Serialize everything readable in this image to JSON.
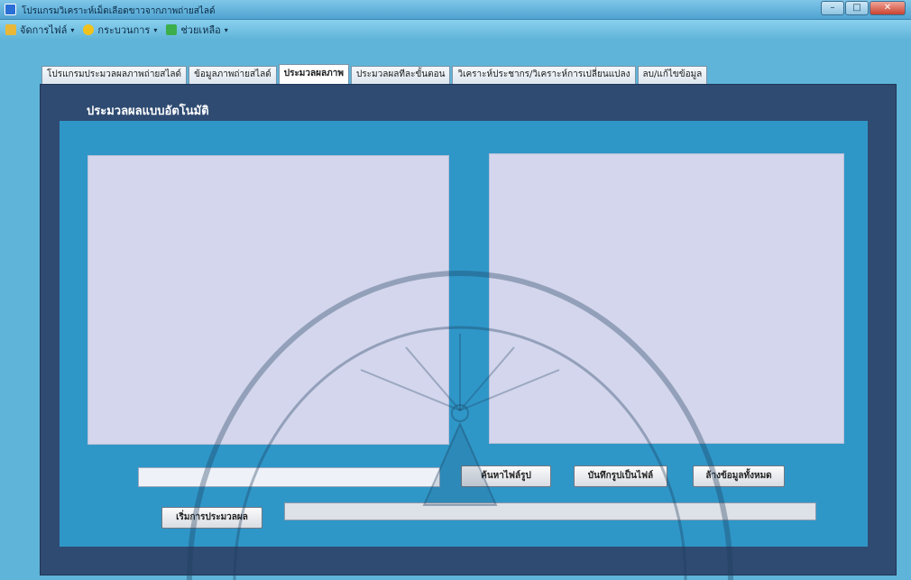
{
  "window": {
    "title": "โปรแกรมวิเคราะห์เม็ดเลือดขาวจากภาพถ่ายสไลด์",
    "controls": [
      "minimize",
      "maximize",
      "close"
    ]
  },
  "menu": {
    "items": [
      {
        "label": "จัดการไฟล์",
        "icon": "folder-icon"
      },
      {
        "label": "กระบวนการ",
        "icon": "gear-icon"
      },
      {
        "label": "ช่วยเหลือ",
        "icon": "help-icon"
      }
    ]
  },
  "tabs": [
    {
      "label": "โปรแกรมประมวลผลภาพถ่ายสไลด์"
    },
    {
      "label": "ข้อมูลภาพถ่ายสไลด์"
    },
    {
      "label": "ประมวลผลภาพ",
      "active": true
    },
    {
      "label": "ประมวลผลทีละขั้นตอน"
    },
    {
      "label": "วิเคราะห์ประชากร/วิเคราะห์การเปลี่ยนแปลง"
    },
    {
      "label": "ลบ/แก้ไขข้อมูล"
    }
  ],
  "panel": {
    "heading": "ประมวลผลแบบอัตโนมัติ"
  },
  "controls": {
    "path_input_value": "",
    "browse_button": "ค้นหาไฟล์รูป",
    "save_button": "บันทึกรูปเป็นไฟล์",
    "clear_button": "ล้างข้อมูลทั้งหมด",
    "start_button": "เริ่มการประมวลผล",
    "progress": 0
  },
  "colors": {
    "background": "#5fb4d9",
    "panel_outer": "#2f4b72",
    "panel_inner": "#2f97c8",
    "preview": "#d3d6ec"
  }
}
